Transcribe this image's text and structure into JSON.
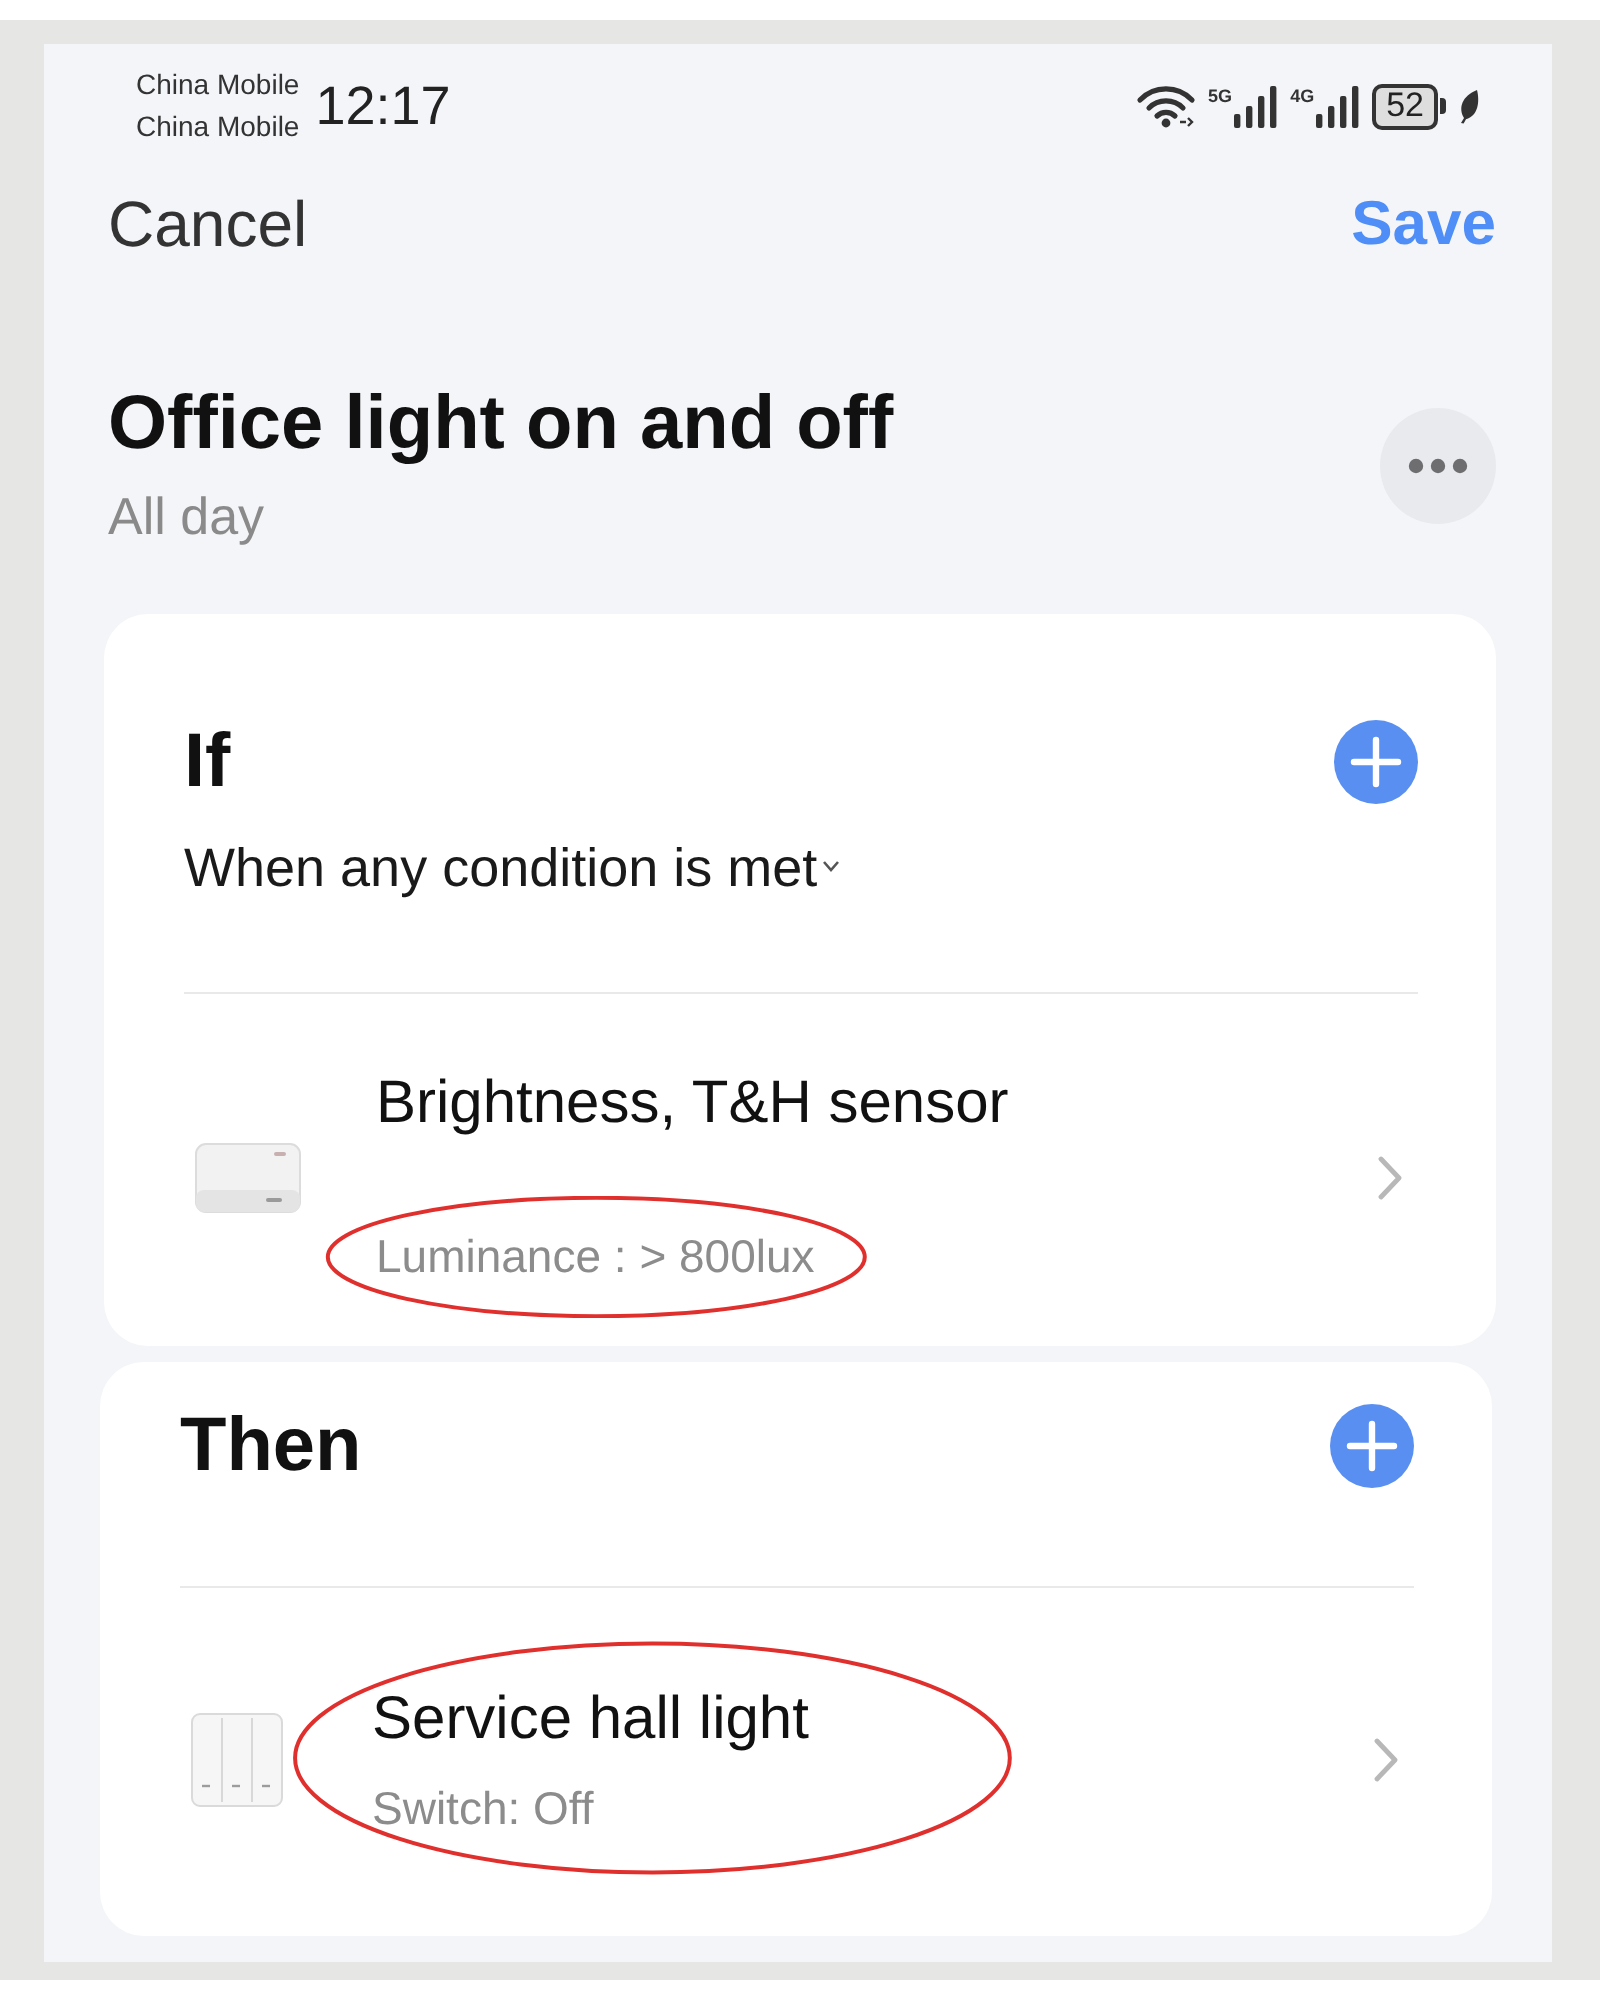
{
  "status_bar": {
    "carriers": [
      "China Mobile",
      "China Mobile"
    ],
    "time": "12:17",
    "networks": [
      "5G",
      "4G"
    ],
    "battery": "52"
  },
  "nav": {
    "cancel": "Cancel",
    "save": "Save"
  },
  "header": {
    "title": "Office light on and off",
    "subtitle": "All day"
  },
  "sections": [
    {
      "title": "If",
      "mode": "When any condition is met",
      "items": [
        {
          "kind": "sensor",
          "name": "Brightness, T&H sensor",
          "detail": "Luminance : > 800lux",
          "name_circled": false,
          "detail_circled": true
        }
      ]
    },
    {
      "title": "Then",
      "items": [
        {
          "kind": "switch",
          "name": "Service hall light",
          "detail": "Switch: Off",
          "name_circled": true,
          "detail_circled": true
        }
      ]
    }
  ]
}
